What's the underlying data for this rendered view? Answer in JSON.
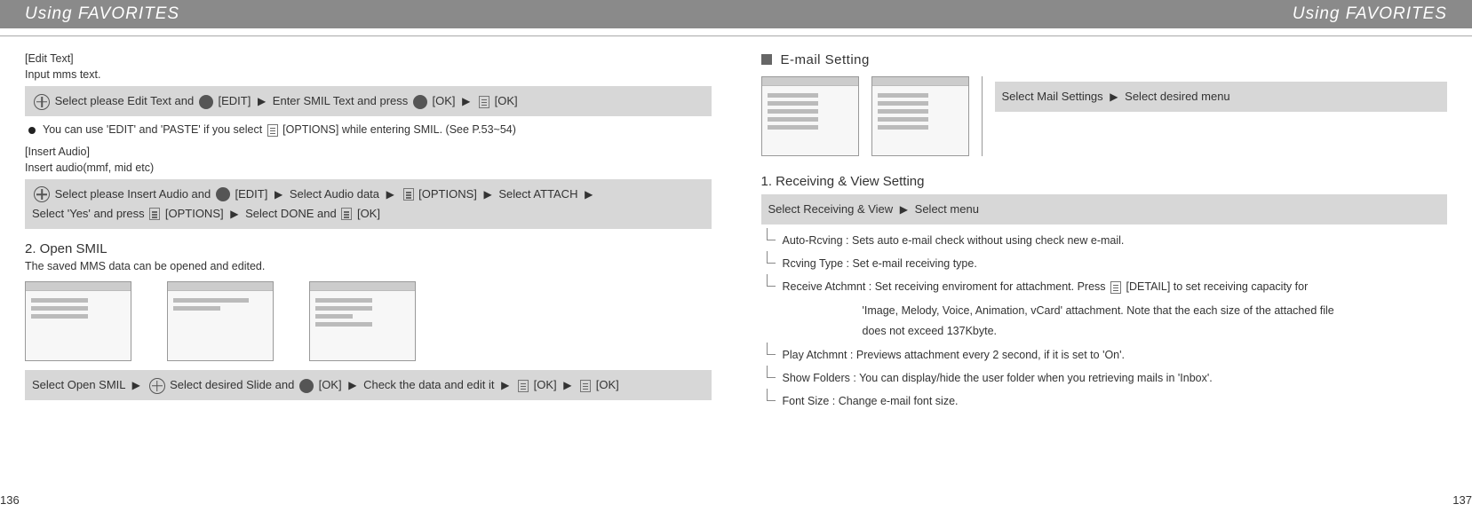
{
  "left": {
    "banner": "Using FAVORITES",
    "editText": {
      "label": "[Edit Text]",
      "body": "Input mms text.",
      "bar": {
        "p1": "Select please Edit Text and",
        "p2": "[EDIT]",
        "p3": "Enter SMIL Text and press",
        "p4": "[OK]",
        "p5": "[OK]"
      },
      "bullet": "You can use 'EDIT' and 'PASTE' if you select",
      "bullet2": "[OPTIONS] while entering SMIL. (See P.53~54)"
    },
    "insertAudio": {
      "label": "[Insert Audio]",
      "body": "Insert audio(mmf, mid etc)",
      "bar": {
        "p1": "Select please Insert Audio and",
        "p2": "[EDIT]",
        "p3": "Select Audio data",
        "p4": "[OPTIONS]",
        "p5": "Select ATTACH",
        "p6": "Select 'Yes' and press",
        "p7": "[OPTIONS]",
        "p8": "Select DONE and",
        "p9": "[OK]"
      }
    },
    "openSmil": {
      "heading": "2. Open SMIL",
      "body": "The saved MMS data can be opened and edited.",
      "bar": {
        "p1": "Select Open SMIL",
        "p2": "Select desired Slide and",
        "p3": "[OK]",
        "p4": "Check the data and edit it",
        "p5": "[OK]",
        "p6": "[OK]"
      }
    },
    "pageNum": "136"
  },
  "right": {
    "banner": "Using FAVORITES",
    "emailSetting": {
      "title": "E-mail Setting",
      "bar": {
        "p1": "Select Mail Settings",
        "p2": "Select desired menu"
      }
    },
    "receiving": {
      "heading": "1. Receiving & View Setting",
      "bar": {
        "p1": "Select Receiving & View",
        "p2": "Select menu"
      },
      "items": {
        "autoRcving": "Auto-Rcving : Sets auto e-mail check without using check new e-mail.",
        "rcvingType": "Rcving Type : Set e-mail receiving type.",
        "receiveAtchmnt": "Receive Atchmnt : Set receiving enviroment for attachment. Press",
        "receiveAtchmnt_b": "[DETAIL] to set receiving capacity for",
        "receiveAtchmnt2": "'Image, Melody, Voice, Animation, vCard' attachment. Note that the each size of the attached file",
        "receiveAtchmnt3": "does not exceed 137Kbyte.",
        "playAtchmnt": "Play Atchmnt : Previews attachment every 2 second, if it is set to 'On'.",
        "showFolders": "Show Folders : You can display/hide the user folder when you retrieving mails in 'Inbox'.",
        "fontSize": "Font Size : Change e-mail font size."
      }
    },
    "pageNum": "137"
  }
}
